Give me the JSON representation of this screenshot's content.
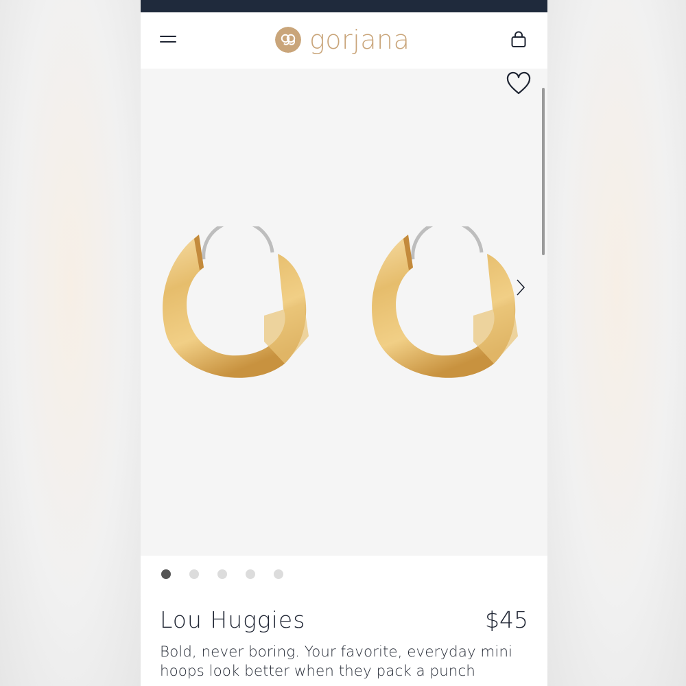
{
  "brand": {
    "name": "gorjana"
  },
  "colors": {
    "status_bar": "#1f2a3c",
    "brand_gold": "#c9a57a",
    "text_dark": "#1f2533",
    "image_bg": "#f5f5f5",
    "gold_light": "#f3d69a",
    "gold_mid": "#e2b766",
    "gold_dark": "#b9853a",
    "wire": "#b9b9b9"
  },
  "header": {
    "menu_icon": "hamburger-menu-icon",
    "logo_icon": "gorjana-monogram-icon",
    "cart_icon": "shopping-bag-icon"
  },
  "gallery": {
    "favorite_icon": "heart-outline-icon",
    "next_icon": "chevron-right-icon",
    "image_count": 5,
    "active_index": 0
  },
  "product": {
    "name": "Lou Huggies",
    "price": "$45",
    "description": "Bold, never boring. Your favorite, everyday mini hoops look better when they pack a punch"
  }
}
